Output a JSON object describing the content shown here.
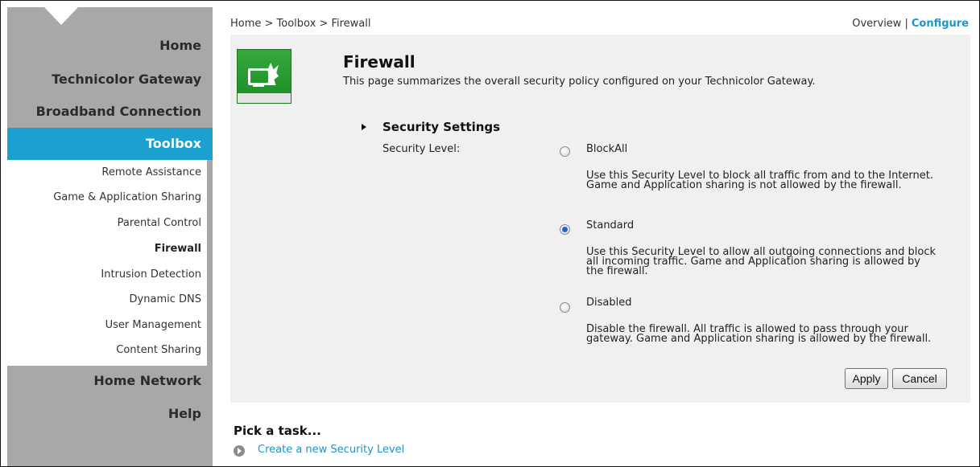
{
  "sidebar": {
    "top_items": [
      {
        "label": "Home"
      },
      {
        "label": "Technicolor Gateway"
      },
      {
        "label": "Broadband Connection"
      }
    ],
    "active_item": {
      "label": "Toolbox"
    },
    "sub_items": [
      {
        "label": "Remote Assistance"
      },
      {
        "label": "Game & Application Sharing"
      },
      {
        "label": "Parental Control"
      },
      {
        "label": "Firewall"
      },
      {
        "label": "Intrusion Detection"
      },
      {
        "label": "Dynamic DNS"
      },
      {
        "label": "User Management"
      },
      {
        "label": "Content Sharing"
      }
    ],
    "bottom_items": [
      {
        "label": "Home Network"
      },
      {
        "label": "Help"
      }
    ]
  },
  "header": {
    "breadcrumb": "Home > Toolbox > Firewall",
    "overview_label": "Overview",
    "separator": "|",
    "configure_label": "Configure"
  },
  "page": {
    "title": "Firewall",
    "description": "This page summarizes the overall security policy configured on your Technicolor Gateway.",
    "icon": "firewall-icon"
  },
  "security_settings": {
    "heading": "Security Settings",
    "level_label": "Security Level:",
    "options": [
      {
        "label": "BlockAll",
        "selected": false,
        "description": "Use this Security Level to block all traffic from and to the Internet. Game and Application sharing is not allowed by the firewall."
      },
      {
        "label": "Standard",
        "selected": true,
        "description": "Use this Security Level to allow all outgoing connections and block all incoming traffic. Game and Application sharing is allowed by the firewall."
      },
      {
        "label": "Disabled",
        "selected": false,
        "description": "Disable the firewall. All traffic is allowed to pass through your gateway. Game and Application sharing is allowed by the firewall."
      }
    ],
    "apply_label": "Apply",
    "cancel_label": "Cancel"
  },
  "tasks": {
    "heading": "Pick a task...",
    "items": [
      {
        "label": "Create a new Security Level"
      }
    ]
  },
  "colors": {
    "accent": "#1ba0d0",
    "sidebar": "#a8a8a8",
    "panel": "#f0f0f0",
    "link": "#1a96c8",
    "icon_green": "#2a9e33"
  }
}
